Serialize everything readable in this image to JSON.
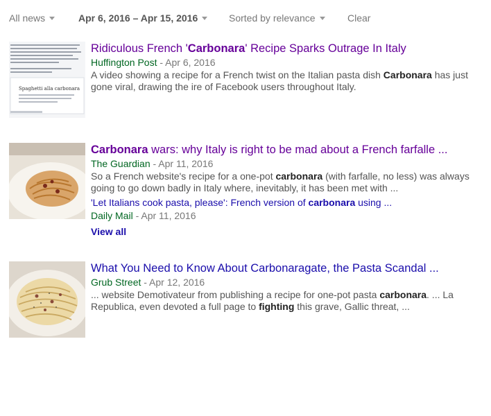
{
  "toolbar": {
    "news_filter": "All news",
    "date_range": "Apr 6, 2016 – Apr 15, 2016",
    "sort": "Sorted by relevance",
    "clear": "Clear"
  },
  "results": [
    {
      "title_pre": "Ridiculous French '",
      "title_bold": "Carbonara",
      "title_post": "' Recipe Sparks Outrage In Italy",
      "source": "Huffington Post",
      "date": " - Apr 6, 2016",
      "snippet_pre": "A video showing a recipe for a French twist on the Italian pasta dish ",
      "snippet_bold": "Carbonara",
      "snippet_post": " has just gone viral, drawing the ire of Facebook users throughout Italy.",
      "thumb_caption": "Spaghetti alla carbonara"
    },
    {
      "title_bold": "Carbonara",
      "title_post": " wars: why Italy is right to be mad about a French farfalle ...",
      "source": "The Guardian",
      "date": " - Apr 11, 2016",
      "snippet_pre": "So a French website's recipe for a one-pot ",
      "snippet_bold": "carbonara",
      "snippet_post": " (with farfalle, no less) was always going to go down badly in Italy where, inevitably, it has been met with ...",
      "sub_pre": "'Let Italians cook pasta, please': French version of ",
      "sub_bold": "carbonara",
      "sub_post": " using ...",
      "sub_source": "Daily Mail",
      "sub_date": " - Apr 11, 2016",
      "view_all": "View all"
    },
    {
      "title": "What You Need to Know About Carbonaragate, the Pasta Scandal ...",
      "source": "Grub Street",
      "date": " - Apr 12, 2016",
      "snippet_pre": "... website Demotivateur from publishing a recipe for one-pot pasta ",
      "snippet_bold": "carbonara",
      "snippet_mid": ". ... La Republica, even devoted a full page to ",
      "snippet_bold2": "fighting",
      "snippet_post": " this grave, Gallic threat, ..."
    }
  ],
  "colors": {
    "link": "#1a0dab",
    "visited": "#660099",
    "source": "#006621"
  }
}
